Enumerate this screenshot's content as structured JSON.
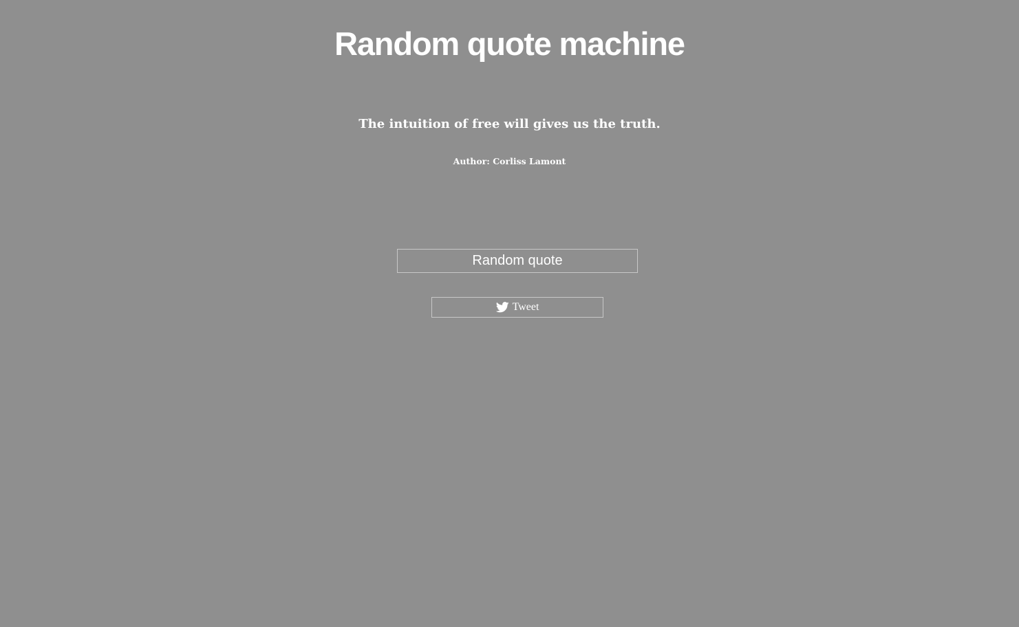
{
  "header": {
    "title": "Random quote machine"
  },
  "quote": {
    "text": "The intuition of free will gives us the truth.",
    "author": "Author: Corliss Lamont"
  },
  "actions": {
    "random_label": "Random quote",
    "tweet_label": "Tweet",
    "tweet_icon": "twitter-bird-icon"
  },
  "colors": {
    "background": "#8f8f8f",
    "text": "#ffffff",
    "border": "#c8c8c8"
  }
}
